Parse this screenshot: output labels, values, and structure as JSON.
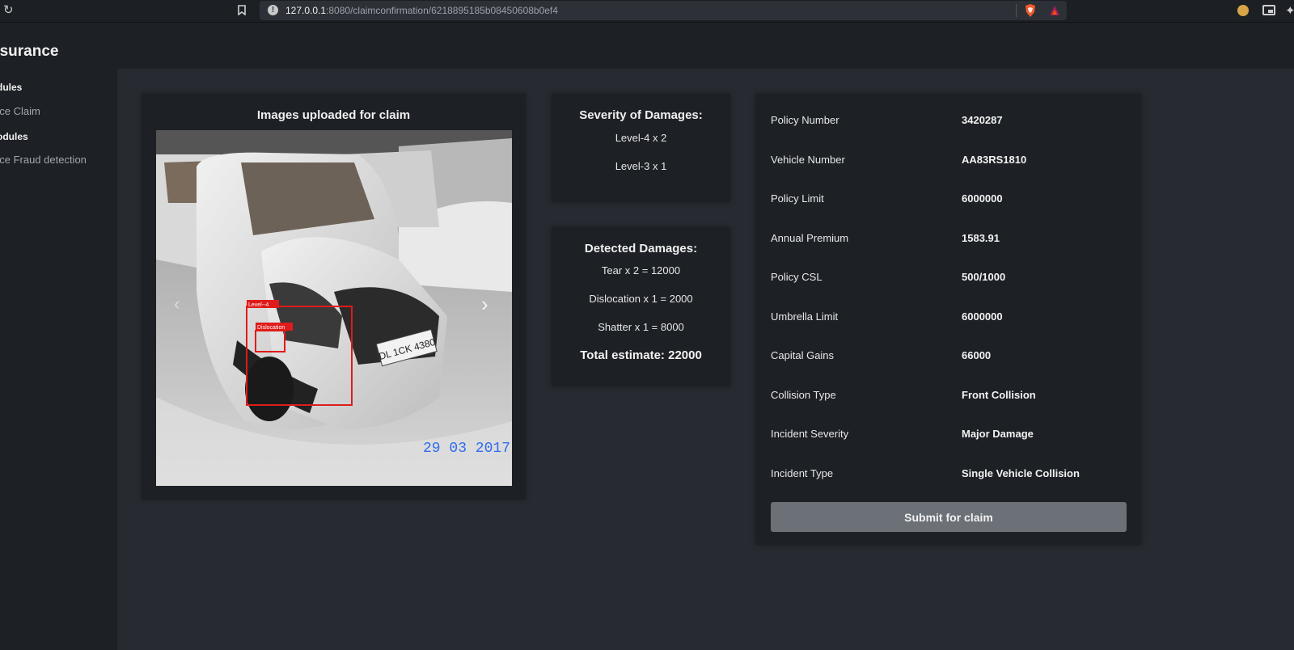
{
  "browser": {
    "url_host": "127.0.0.1",
    "url_rest": ":8080/claimconfirmation/6218895185b08450608b0ef4"
  },
  "app": {
    "brand": "nsurance"
  },
  "sidebar": {
    "items": [
      {
        "label": "dules",
        "type": "heading"
      },
      {
        "label": "nce Claim",
        "type": "link"
      },
      {
        "label": "odules",
        "type": "heading"
      },
      {
        "label": "nce Fraud detection",
        "type": "link"
      }
    ]
  },
  "images_panel": {
    "title": "Images uploaded for claim",
    "photo_date_stamp": "29 03 2017",
    "plate_text": "DL 1CK 4380",
    "box_label_outer": "Level--4",
    "box_label_inner": "Dislocation"
  },
  "severity": {
    "title": "Severity of Damages:",
    "levels": [
      "Level-4 x 2",
      "Level-3 x 1"
    ]
  },
  "damages": {
    "title": "Detected Damages:",
    "items": [
      "Tear x 2 = 12000",
      "Dislocation x 1 = 2000",
      "Shatter x 1 = 8000"
    ],
    "total": "Total estimate: 22000"
  },
  "policy": {
    "rows": [
      {
        "label": "Policy Number",
        "value": "3420287"
      },
      {
        "label": "Vehicle Number",
        "value": "AA83RS1810"
      },
      {
        "label": "Policy Limit",
        "value": "6000000"
      },
      {
        "label": "Annual Premium",
        "value": "1583.91"
      },
      {
        "label": "Policy CSL",
        "value": "500/1000"
      },
      {
        "label": "Umbrella Limit",
        "value": "6000000"
      },
      {
        "label": "Capital Gains",
        "value": "66000"
      },
      {
        "label": "Collision Type",
        "value": "Front Collision"
      },
      {
        "label": "Incident Severity",
        "value": "Major Damage"
      },
      {
        "label": "Incident Type",
        "value": "Single Vehicle Collision"
      }
    ],
    "submit_label": "Submit for claim"
  },
  "colors": {
    "detection_box": "#e01b1b",
    "date_stamp": "#2f6cf0",
    "panel_bg": "#1d2025",
    "page_bg": "#272b31"
  }
}
